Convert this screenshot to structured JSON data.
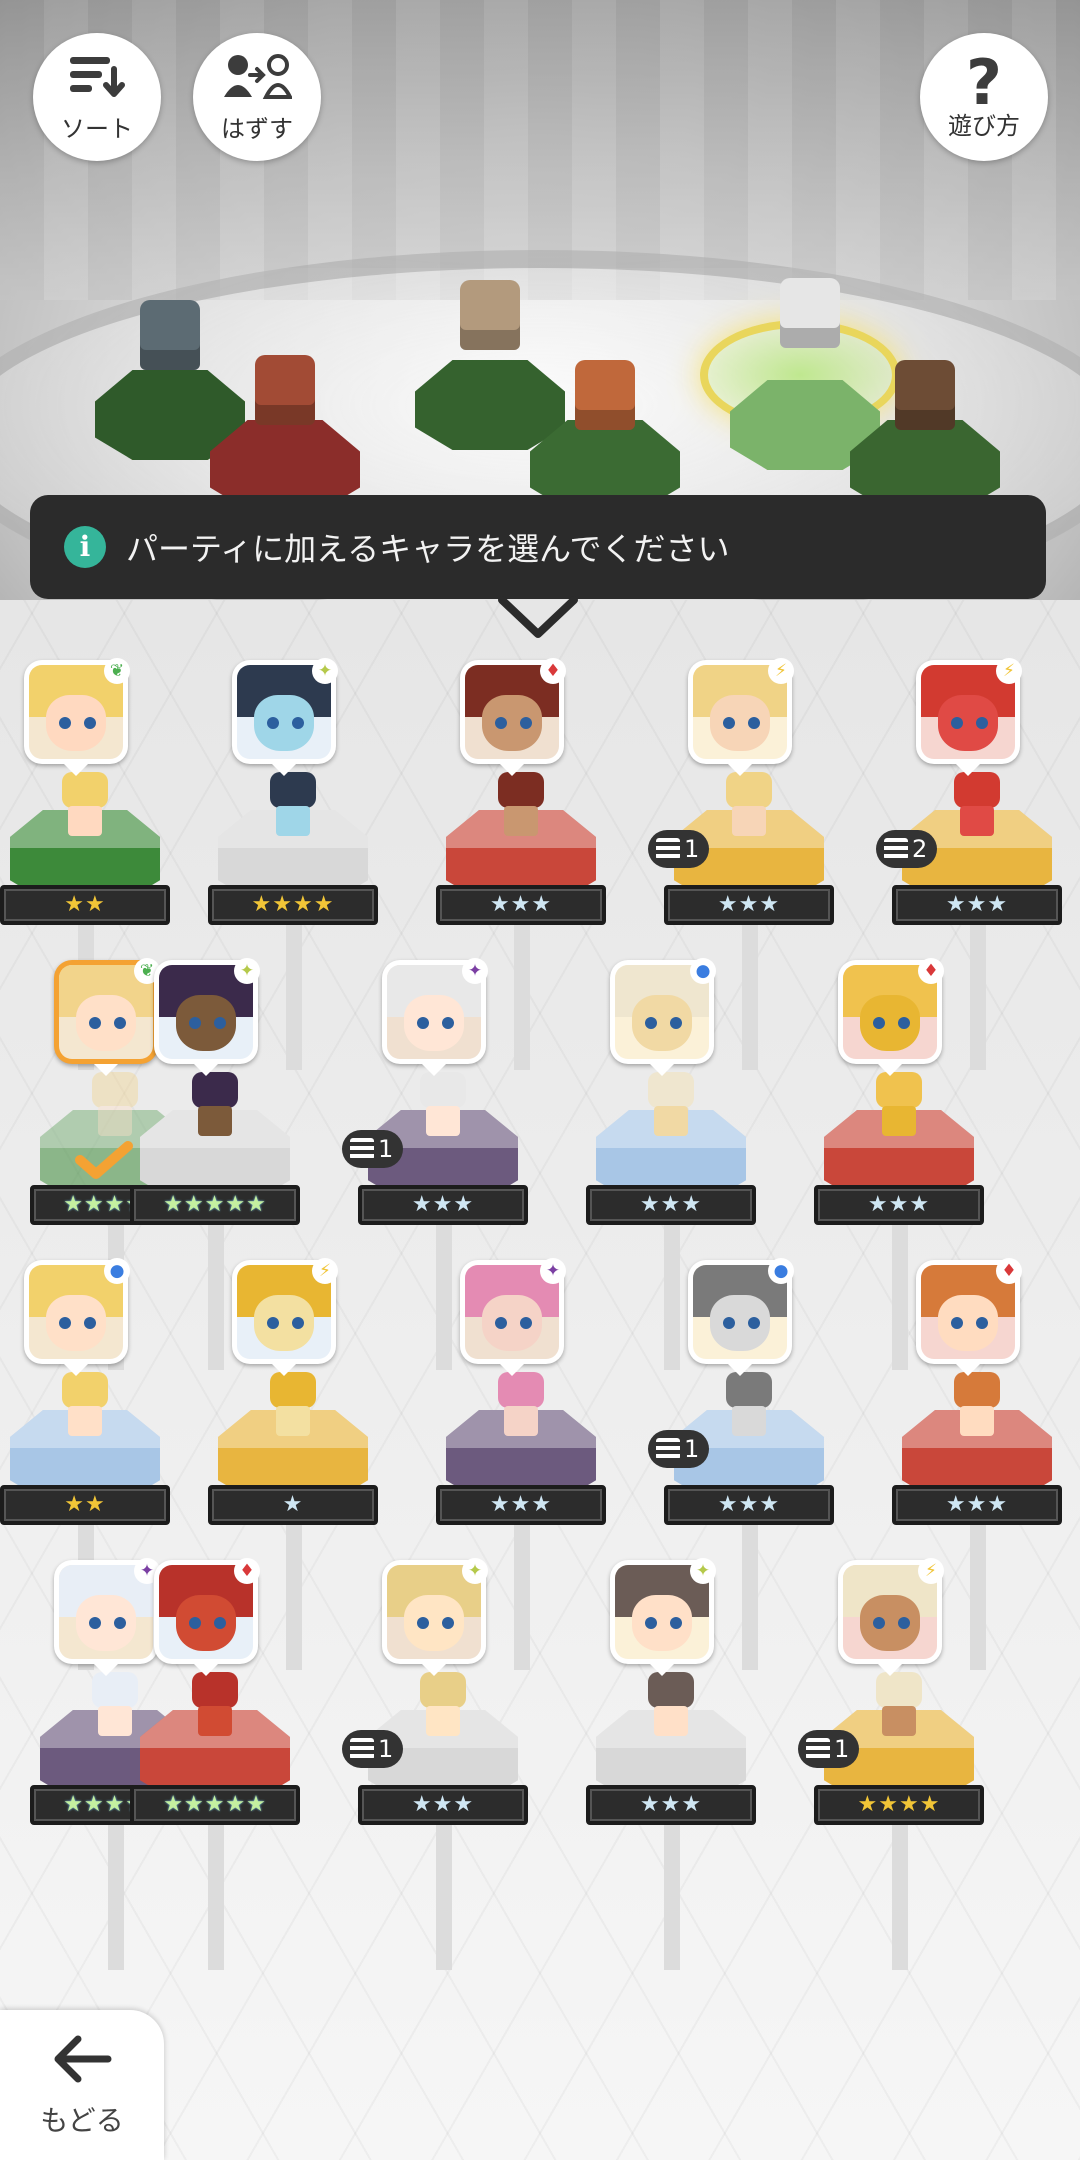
{
  "top_buttons": {
    "sort": {
      "label": "ソート",
      "icon": "sort-icon"
    },
    "remove": {
      "label": "はずす",
      "icon": "remove-member-icon"
    },
    "help": {
      "label": "遊び方",
      "icon": "question-mark-icon"
    }
  },
  "banner": {
    "icon": "info-icon",
    "message": "パーティに加えるキャラを選んでください"
  },
  "back": {
    "label": "もどる",
    "icon": "back-arrow-icon"
  },
  "colors": {
    "banner_bg": "#2b2b2b",
    "info_icon": "#35b59a",
    "selected_frame": "#f4a233",
    "star_gold": "#f1c537",
    "star_silver": "#cfe6f3"
  },
  "party": {
    "slots": 6,
    "active_slot": 5
  },
  "roster": [
    {
      "id": "r1c0",
      "element": "wind",
      "stars": "★★",
      "star_style": "gold",
      "badge": "",
      "selected": false
    },
    {
      "id": "r1c1",
      "element": "light",
      "stars": "★★★★",
      "star_style": "gold",
      "badge": "",
      "selected": false
    },
    {
      "id": "r1c2",
      "element": "fire",
      "stars": "★★★",
      "star_style": "silver",
      "badge": "",
      "selected": false
    },
    {
      "id": "r1c3",
      "element": "thunder",
      "stars": "★★★",
      "star_style": "silver",
      "badge": "1",
      "selected": false
    },
    {
      "id": "r1c4",
      "element": "thunder",
      "stars": "★★★",
      "star_style": "silver",
      "badge": "2",
      "selected": false
    },
    {
      "id": "r2c0",
      "element": "wind",
      "stars": "★★★★★",
      "star_style": "rainbow",
      "badge": "",
      "selected": true
    },
    {
      "id": "r2c1",
      "element": "light",
      "stars": "★★★★★",
      "star_style": "rainbow",
      "badge": "",
      "selected": false
    },
    {
      "id": "r2c2",
      "element": "dark",
      "stars": "★★★",
      "star_style": "silver",
      "badge": "1",
      "selected": false
    },
    {
      "id": "r2c3",
      "element": "water",
      "stars": "★★★",
      "star_style": "silver",
      "badge": "",
      "selected": false
    },
    {
      "id": "r2c4",
      "element": "fire",
      "stars": "★★★",
      "star_style": "silver",
      "badge": "",
      "selected": false
    },
    {
      "id": "r3c0",
      "element": "water",
      "stars": "★★",
      "star_style": "gold",
      "badge": "",
      "selected": false
    },
    {
      "id": "r3c1",
      "element": "thunder",
      "stars": "★",
      "star_style": "silver",
      "badge": "",
      "selected": false
    },
    {
      "id": "r3c2",
      "element": "dark",
      "stars": "★★★",
      "star_style": "silver",
      "badge": "",
      "selected": false
    },
    {
      "id": "r3c3",
      "element": "water",
      "stars": "★★★",
      "star_style": "silver",
      "badge": "1",
      "selected": false
    },
    {
      "id": "r3c4",
      "element": "fire",
      "stars": "★★★",
      "star_style": "silver",
      "badge": "",
      "selected": false
    },
    {
      "id": "r4c0",
      "element": "dark",
      "stars": "★★★★★",
      "star_style": "rainbow",
      "badge": "",
      "selected": false
    },
    {
      "id": "r4c1",
      "element": "fire",
      "stars": "★★★★★",
      "star_style": "rainbow",
      "badge": "",
      "selected": false
    },
    {
      "id": "r4c2",
      "element": "light",
      "stars": "★★★",
      "star_style": "silver",
      "badge": "1",
      "selected": false
    },
    {
      "id": "r4c3",
      "element": "light",
      "stars": "★★★",
      "star_style": "silver",
      "badge": "",
      "selected": false
    },
    {
      "id": "r4c4",
      "element": "thunder",
      "stars": "★★★★",
      "star_style": "gold",
      "badge": "1",
      "selected": false
    }
  ]
}
